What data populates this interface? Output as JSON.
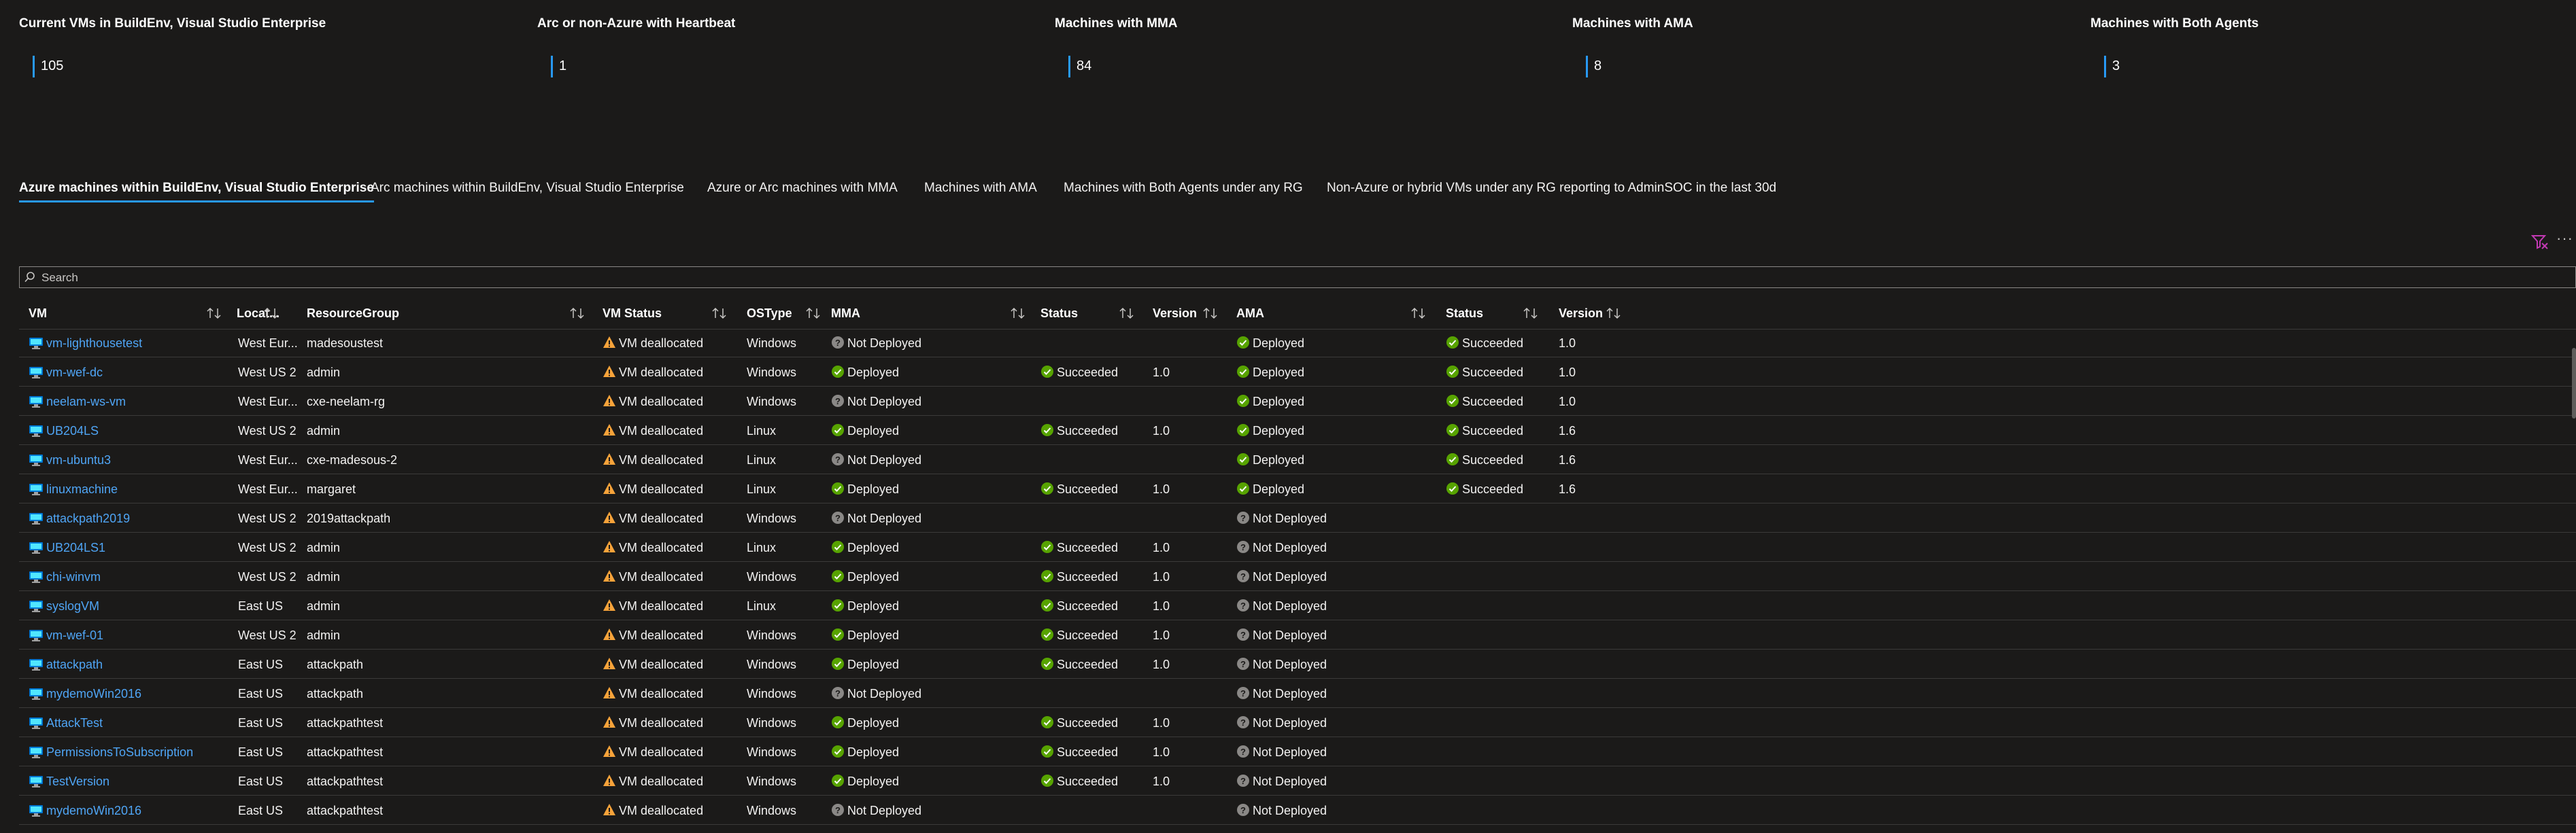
{
  "tiles": [
    {
      "title": "Current VMs in BuildEnv, Visual Studio Enterprise",
      "value": "105"
    },
    {
      "title": "Arc or non-Azure with Heartbeat",
      "value": "1"
    },
    {
      "title": "Machines with MMA",
      "value": "84"
    },
    {
      "title": "Machines with AMA",
      "value": "8"
    },
    {
      "title": "Machines with Both Agents",
      "value": "3"
    }
  ],
  "tabs": [
    "Azure machines within BuildEnv, Visual Studio Enterprise",
    "Arc machines within BuildEnv, Visual Studio Enterprise",
    "Azure or Arc machines with MMA",
    "Machines with AMA",
    "Machines with Both Agents under any RG",
    "Non-Azure or hybrid VMs under any RG reporting to AdminSOC in the last 30d"
  ],
  "search": {
    "placeholder": "Search"
  },
  "columns": [
    "VM",
    "Locat...",
    "ResourceGroup",
    "VM Status",
    "OSType",
    "MMA",
    "Status",
    "Version",
    "AMA",
    "Status",
    "Version"
  ],
  "colors": {
    "accent": "#2899f5",
    "link": "#4fa5f5",
    "success": "#57a300",
    "warning": "#f7a33a",
    "unknown": "#8a8886"
  },
  "rows": [
    {
      "vm": "vm-lighthousetest",
      "loc": "West Eur...",
      "rg": "madesoustest",
      "vmstatus": "VM deallocated",
      "os": "Windows",
      "mma": "Not Deployed",
      "mma_status": "",
      "mma_version": "",
      "ama": "Deployed",
      "ama_status": "Succeeded",
      "ama_version": "1.0"
    },
    {
      "vm": "vm-wef-dc",
      "loc": "West US 2",
      "rg": "admin",
      "vmstatus": "VM deallocated",
      "os": "Windows",
      "mma": "Deployed",
      "mma_status": "Succeeded",
      "mma_version": "1.0",
      "ama": "Deployed",
      "ama_status": "Succeeded",
      "ama_version": "1.0"
    },
    {
      "vm": "neelam-ws-vm",
      "loc": "West Eur...",
      "rg": "cxe-neelam-rg",
      "vmstatus": "VM deallocated",
      "os": "Windows",
      "mma": "Not Deployed",
      "mma_status": "",
      "mma_version": "",
      "ama": "Deployed",
      "ama_status": "Succeeded",
      "ama_version": "1.0"
    },
    {
      "vm": "UB204LS",
      "loc": "West US 2",
      "rg": "admin",
      "vmstatus": "VM deallocated",
      "os": "Linux",
      "mma": "Deployed",
      "mma_status": "Succeeded",
      "mma_version": "1.0",
      "ama": "Deployed",
      "ama_status": "Succeeded",
      "ama_version": "1.6"
    },
    {
      "vm": "vm-ubuntu3",
      "loc": "West Eur...",
      "rg": "cxe-madesous-2",
      "vmstatus": "VM deallocated",
      "os": "Linux",
      "mma": "Not Deployed",
      "mma_status": "",
      "mma_version": "",
      "ama": "Deployed",
      "ama_status": "Succeeded",
      "ama_version": "1.6"
    },
    {
      "vm": "linuxmachine",
      "loc": "West Eur...",
      "rg": "margaret",
      "vmstatus": "VM deallocated",
      "os": "Linux",
      "mma": "Deployed",
      "mma_status": "Succeeded",
      "mma_version": "1.0",
      "ama": "Deployed",
      "ama_status": "Succeeded",
      "ama_version": "1.6"
    },
    {
      "vm": "attackpath2019",
      "loc": "West US 2",
      "rg": "2019attackpath",
      "vmstatus": "VM deallocated",
      "os": "Windows",
      "mma": "Not Deployed",
      "mma_status": "",
      "mma_version": "",
      "ama": "Not Deployed",
      "ama_status": "",
      "ama_version": ""
    },
    {
      "vm": "UB204LS1",
      "loc": "West US 2",
      "rg": "admin",
      "vmstatus": "VM deallocated",
      "os": "Linux",
      "mma": "Deployed",
      "mma_status": "Succeeded",
      "mma_version": "1.0",
      "ama": "Not Deployed",
      "ama_status": "",
      "ama_version": ""
    },
    {
      "vm": "chi-winvm",
      "loc": "West US 2",
      "rg": "admin",
      "vmstatus": "VM deallocated",
      "os": "Windows",
      "mma": "Deployed",
      "mma_status": "Succeeded",
      "mma_version": "1.0",
      "ama": "Not Deployed",
      "ama_status": "",
      "ama_version": ""
    },
    {
      "vm": "syslogVM",
      "loc": "East US",
      "rg": "admin",
      "vmstatus": "VM deallocated",
      "os": "Linux",
      "mma": "Deployed",
      "mma_status": "Succeeded",
      "mma_version": "1.0",
      "ama": "Not Deployed",
      "ama_status": "",
      "ama_version": ""
    },
    {
      "vm": "vm-wef-01",
      "loc": "West US 2",
      "rg": "admin",
      "vmstatus": "VM deallocated",
      "os": "Windows",
      "mma": "Deployed",
      "mma_status": "Succeeded",
      "mma_version": "1.0",
      "ama": "Not Deployed",
      "ama_status": "",
      "ama_version": ""
    },
    {
      "vm": "attackpath",
      "loc": "East US",
      "rg": "attackpath",
      "vmstatus": "VM deallocated",
      "os": "Windows",
      "mma": "Deployed",
      "mma_status": "Succeeded",
      "mma_version": "1.0",
      "ama": "Not Deployed",
      "ama_status": "",
      "ama_version": ""
    },
    {
      "vm": "mydemoWin2016",
      "loc": "East US",
      "rg": "attackpath",
      "vmstatus": "VM deallocated",
      "os": "Windows",
      "mma": "Not Deployed",
      "mma_status": "",
      "mma_version": "",
      "ama": "Not Deployed",
      "ama_status": "",
      "ama_version": ""
    },
    {
      "vm": "AttackTest",
      "loc": "East US",
      "rg": "attackpathtest",
      "vmstatus": "VM deallocated",
      "os": "Windows",
      "mma": "Deployed",
      "mma_status": "Succeeded",
      "mma_version": "1.0",
      "ama": "Not Deployed",
      "ama_status": "",
      "ama_version": ""
    },
    {
      "vm": "PermissionsToSubscription",
      "loc": "East US",
      "rg": "attackpathtest",
      "vmstatus": "VM deallocated",
      "os": "Windows",
      "mma": "Deployed",
      "mma_status": "Succeeded",
      "mma_version": "1.0",
      "ama": "Not Deployed",
      "ama_status": "",
      "ama_version": ""
    },
    {
      "vm": "TestVersion",
      "loc": "East US",
      "rg": "attackpathtest",
      "vmstatus": "VM deallocated",
      "os": "Windows",
      "mma": "Deployed",
      "mma_status": "Succeeded",
      "mma_version": "1.0",
      "ama": "Not Deployed",
      "ama_status": "",
      "ama_version": ""
    },
    {
      "vm": "mydemoWin2016",
      "loc": "East US",
      "rg": "attackpathtest",
      "vmstatus": "VM deallocated",
      "os": "Windows",
      "mma": "Not Deployed",
      "mma_status": "",
      "mma_version": "",
      "ama": "Not Deployed",
      "ama_status": "",
      "ama_version": ""
    }
  ]
}
